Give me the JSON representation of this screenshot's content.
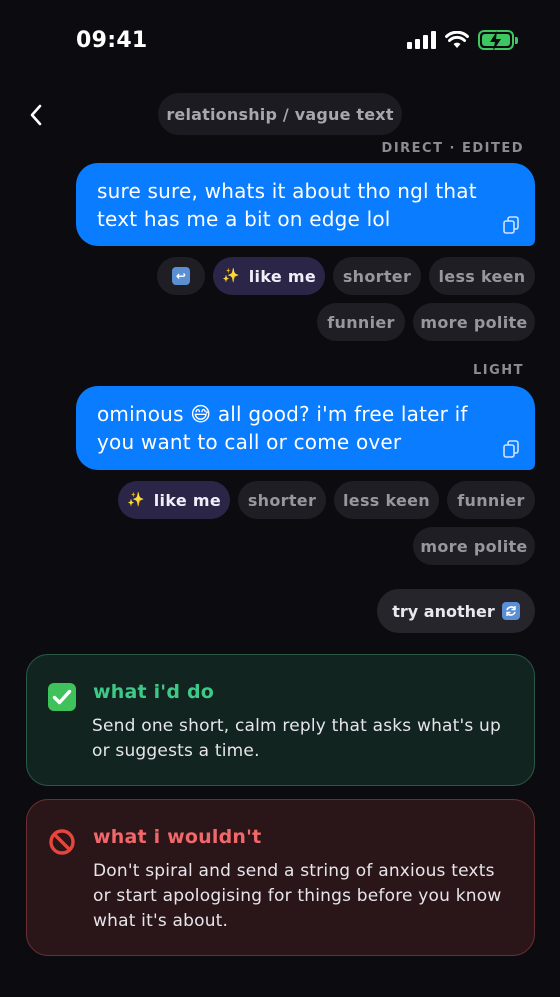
{
  "status_bar": {
    "time": "09:41"
  },
  "header": {
    "title": "relationship / vague text"
  },
  "replies": [
    {
      "style_label": "DIRECT · EDITED",
      "text": "sure sure, whats it about tho ngl that text has me a bit on edge lol",
      "chips": {
        "undo": "↩",
        "like_me": "like me",
        "shorter": "shorter",
        "less_keen": "less keen",
        "funnier": "funnier",
        "more_polite": "more polite"
      }
    },
    {
      "style_label": "LIGHT",
      "text": "ominous 😅  all good? i'm free later if you want to call or come over",
      "chips": {
        "like_me": "like me",
        "shorter": "shorter",
        "less_keen": "less keen",
        "funnier": "funnier",
        "more_polite": "more polite"
      }
    }
  ],
  "try_another": {
    "label": "try another"
  },
  "advice": {
    "do": {
      "title": "what i'd do",
      "text": "Send one short, calm reply that asks what's up or suggests a time."
    },
    "dont": {
      "title": "what i wouldn't",
      "text": "Don't spiral and send a string of anxious texts or start apologising for things before you know what it's about."
    }
  },
  "icons": {
    "back": "chevron-left-icon",
    "copy": "copy-icon",
    "sparkle": "sparkle-icon",
    "refresh": "refresh-icon",
    "check": "check-mark-icon",
    "prohibited": "prohibited-icon"
  },
  "colors": {
    "accent_blue": "#0a7cff",
    "do_green": "#3fc988",
    "dont_red": "#f1676a",
    "active_chip": "#2b2547"
  }
}
